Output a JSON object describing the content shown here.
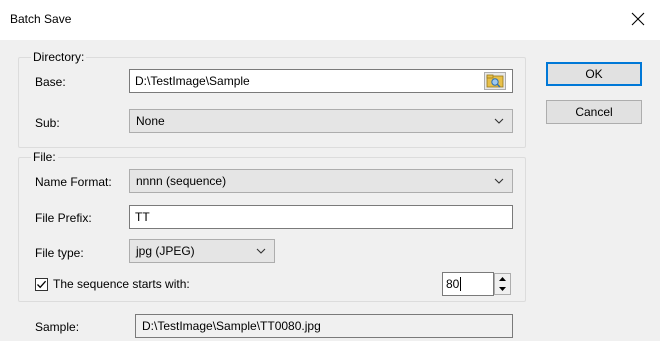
{
  "window": {
    "title": "Batch Save"
  },
  "directory": {
    "group_title": "Directory:",
    "base_label": "Base:",
    "base_value": "D:\\TestImage\\Sample",
    "sub_label": "Sub:",
    "sub_value": "None"
  },
  "file": {
    "group_title": "File:",
    "name_format_label": "Name Format:",
    "name_format_value": "nnnn (sequence)",
    "prefix_label": "File Prefix:",
    "prefix_value": "TT",
    "type_label": "File type:",
    "type_value": "jpg (JPEG)",
    "sequence_checkbox_label": "The sequence starts with:",
    "sequence_checked": true,
    "sequence_start_value": "80"
  },
  "sample": {
    "label": "Sample:",
    "value": "D:\\TestImage\\Sample\\TT0080.jpg"
  },
  "buttons": {
    "ok_label": "OK",
    "cancel_label": "Cancel"
  },
  "icons": {
    "close": "close-icon",
    "browse": "folder-browse-icon",
    "dropdown": "chevron-down-icon",
    "checkmark": "checkmark-icon",
    "spin_up": "spin-up-icon",
    "spin_down": "spin-down-icon"
  },
  "colors": {
    "default_button_border": "#0078d7",
    "dialog_background": "#f0f0f0"
  }
}
